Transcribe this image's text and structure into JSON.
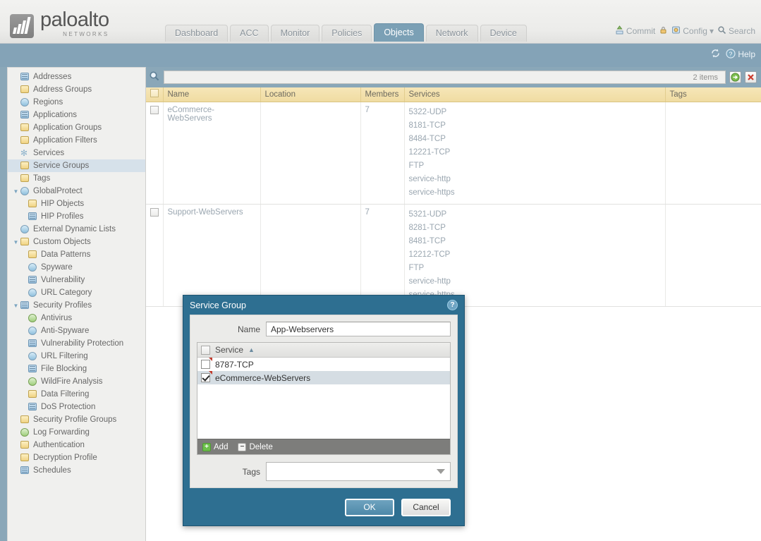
{
  "brand": {
    "name": "paloalto",
    "tagline": "NETWORKS"
  },
  "nav": {
    "tabs": [
      {
        "label": "Dashboard",
        "active": false
      },
      {
        "label": "ACC",
        "active": false
      },
      {
        "label": "Monitor",
        "active": false
      },
      {
        "label": "Policies",
        "active": false
      },
      {
        "label": "Objects",
        "active": true
      },
      {
        "label": "Network",
        "active": false
      },
      {
        "label": "Device",
        "active": false
      }
    ],
    "actions": [
      {
        "label": "Commit",
        "icon": "commit-icon"
      },
      {
        "label": "",
        "icon": "lock-icon"
      },
      {
        "label": "Config",
        "icon": "config-icon",
        "caret": "▾"
      },
      {
        "label": "Search",
        "icon": "search-icon"
      }
    ]
  },
  "band": {
    "refresh_icon": "refresh-icon",
    "help_label": "Help",
    "help_icon": "help-icon"
  },
  "sidebar": {
    "items": [
      {
        "label": "Addresses",
        "depth": 0,
        "icon": "addresses-icon",
        "twisty": "",
        "selected": false
      },
      {
        "label": "Address Groups",
        "depth": 0,
        "icon": "address-groups-icon",
        "twisty": "",
        "selected": false
      },
      {
        "label": "Regions",
        "depth": 0,
        "icon": "regions-icon",
        "twisty": "",
        "selected": false
      },
      {
        "label": "Applications",
        "depth": 0,
        "icon": "applications-icon",
        "twisty": "",
        "selected": false
      },
      {
        "label": "Application Groups",
        "depth": 0,
        "icon": "application-groups-icon",
        "twisty": "",
        "selected": false
      },
      {
        "label": "Application Filters",
        "depth": 0,
        "icon": "application-filters-icon",
        "twisty": "",
        "selected": false
      },
      {
        "label": "Services",
        "depth": 0,
        "icon": "services-icon",
        "twisty": "",
        "selected": false
      },
      {
        "label": "Service Groups",
        "depth": 0,
        "icon": "service-groups-icon",
        "twisty": "",
        "selected": true
      },
      {
        "label": "Tags",
        "depth": 0,
        "icon": "tags-icon",
        "twisty": "",
        "selected": false
      },
      {
        "label": "GlobalProtect",
        "depth": 0,
        "icon": "globalprotect-icon",
        "twisty": "▼",
        "selected": false
      },
      {
        "label": "HIP Objects",
        "depth": 1,
        "icon": "hip-objects-icon",
        "twisty": "",
        "selected": false
      },
      {
        "label": "HIP Profiles",
        "depth": 1,
        "icon": "hip-profiles-icon",
        "twisty": "",
        "selected": false
      },
      {
        "label": "External Dynamic Lists",
        "depth": 0,
        "icon": "external-dynamic-lists-icon",
        "twisty": "",
        "selected": false
      },
      {
        "label": "Custom Objects",
        "depth": 0,
        "icon": "custom-objects-icon",
        "twisty": "▼",
        "selected": false
      },
      {
        "label": "Data Patterns",
        "depth": 1,
        "icon": "data-patterns-icon",
        "twisty": "",
        "selected": false
      },
      {
        "label": "Spyware",
        "depth": 1,
        "icon": "spyware-icon",
        "twisty": "",
        "selected": false
      },
      {
        "label": "Vulnerability",
        "depth": 1,
        "icon": "vulnerability-icon",
        "twisty": "",
        "selected": false
      },
      {
        "label": "URL Category",
        "depth": 1,
        "icon": "url-category-icon",
        "twisty": "",
        "selected": false
      },
      {
        "label": "Security Profiles",
        "depth": 0,
        "icon": "security-profiles-icon",
        "twisty": "▼",
        "selected": false
      },
      {
        "label": "Antivirus",
        "depth": 1,
        "icon": "antivirus-icon",
        "twisty": "",
        "selected": false
      },
      {
        "label": "Anti-Spyware",
        "depth": 1,
        "icon": "anti-spyware-icon",
        "twisty": "",
        "selected": false
      },
      {
        "label": "Vulnerability Protection",
        "depth": 1,
        "icon": "vulnerability-protection-icon",
        "twisty": "",
        "selected": false
      },
      {
        "label": "URL Filtering",
        "depth": 1,
        "icon": "url-filtering-icon",
        "twisty": "",
        "selected": false
      },
      {
        "label": "File Blocking",
        "depth": 1,
        "icon": "file-blocking-icon",
        "twisty": "",
        "selected": false
      },
      {
        "label": "WildFire Analysis",
        "depth": 1,
        "icon": "wildfire-analysis-icon",
        "twisty": "",
        "selected": false
      },
      {
        "label": "Data Filtering",
        "depth": 1,
        "icon": "data-filtering-icon",
        "twisty": "",
        "selected": false
      },
      {
        "label": "DoS Protection",
        "depth": 1,
        "icon": "dos-protection-icon",
        "twisty": "",
        "selected": false
      },
      {
        "label": "Security Profile Groups",
        "depth": 0,
        "icon": "security-profile-groups-icon",
        "twisty": "",
        "selected": false
      },
      {
        "label": "Log Forwarding",
        "depth": 0,
        "icon": "log-forwarding-icon",
        "twisty": "",
        "selected": false
      },
      {
        "label": "Authentication",
        "depth": 0,
        "icon": "authentication-icon",
        "twisty": "",
        "selected": false
      },
      {
        "label": "Decryption Profile",
        "depth": 0,
        "icon": "decryption-profile-icon",
        "twisty": "",
        "selected": false
      },
      {
        "label": "Schedules",
        "depth": 0,
        "icon": "schedules-icon",
        "twisty": "",
        "selected": false
      }
    ]
  },
  "search": {
    "placeholder": "",
    "value": "",
    "icon": "search-icon",
    "item_count": "2 items",
    "apply_icon": "apply-filter-icon",
    "clear_icon": "clear-filter-icon"
  },
  "table": {
    "columns": [
      "Name",
      "Location",
      "Members",
      "Services",
      "Tags"
    ],
    "rows": [
      {
        "name": "eCommerce-WebServers",
        "location": "",
        "members": "7",
        "services": [
          "5322-UDP",
          "8181-TCP",
          "8484-TCP",
          "12221-TCP",
          "FTP",
          "service-http",
          "service-https"
        ],
        "tags": ""
      },
      {
        "name": "Support-WebServers",
        "location": "",
        "members": "7",
        "services": [
          "5321-UDP",
          "8281-TCP",
          "8481-TCP",
          "12212-TCP",
          "FTP",
          "service-http",
          "service-https"
        ],
        "tags": ""
      }
    ]
  },
  "dialog": {
    "title": "Service Group",
    "help_icon": "help-icon",
    "name_label": "Name",
    "name_value": "App-Webservers",
    "name_placeholder": "",
    "list_header": "Service",
    "sort_arrow": "▲",
    "list_items": [
      {
        "label": "8787-TCP",
        "checked": false,
        "selected": false
      },
      {
        "label": "eCommerce-WebServers",
        "checked": true,
        "selected": true
      }
    ],
    "add_label": "Add",
    "delete_label": "Delete",
    "tags_label": "Tags",
    "tags_value": "",
    "ok_label": "OK",
    "cancel_label": "Cancel"
  },
  "colors": {
    "band": "#84a3b7",
    "accent_tab": "#7ba0b5",
    "dialog_header": "#2e6f91",
    "grid_header": "#f0dca2",
    "selected_tree": "#d6e1ea"
  }
}
